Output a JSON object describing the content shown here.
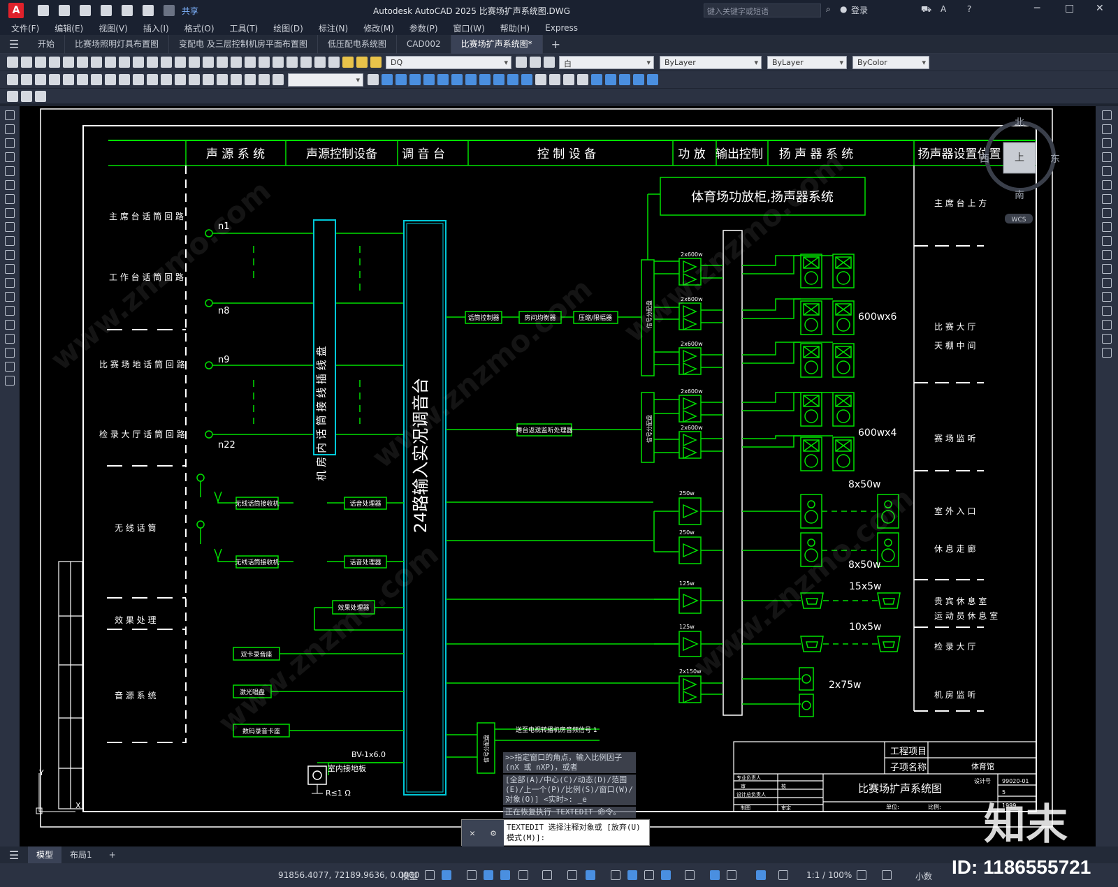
{
  "title_bar": {
    "app_title": "Autodesk AutoCAD 2025    比赛场扩声系统图.DWG",
    "share_label": "共享",
    "search_placeholder": "键入关键字或短语",
    "login_label": "登录"
  },
  "menu": [
    "文件(F)",
    "编辑(E)",
    "视图(V)",
    "插入(I)",
    "格式(O)",
    "工具(T)",
    "绘图(D)",
    "标注(N)",
    "修改(M)",
    "参数(P)",
    "窗口(W)",
    "帮助(H)",
    "Express"
  ],
  "doc_tabs": [
    "开始",
    "比赛场照明灯具布置图",
    "变配电 及三层控制机房平面布置图",
    "低压配电系统图",
    "CAD002",
    "比赛场扩声系统图*"
  ],
  "active_tab_index": 5,
  "toolbar": {
    "layer_value": "DQ",
    "color_value": "白",
    "linetype_value": "ByLayer",
    "lineweight_value": "ByLayer",
    "plotstyle_value": "ByColor"
  },
  "drawing": {
    "headers": [
      "声 源 系 统",
      "声源控制设备",
      "调 音 台",
      "控 制 设 备",
      "功 放",
      "输出控制",
      "扬 声 器 系 统",
      "扬声器设置位置"
    ],
    "mic_groups": [
      "主 席 台 话 筒 回 路",
      "工 作 台 话 筒 回 路",
      "比 赛 场 地 话 筒 回 路",
      "检 录 大 厅 话 筒 回 路",
      "无 线 话 筒",
      "效 果 处 理",
      "音 源 系 统"
    ],
    "node_labels": [
      "n1",
      "n8",
      "n9",
      "n22"
    ],
    "patch_panel": "机 房 内 话 筒 接 线 插 线 盘",
    "mixer": "24路输入实况调音台",
    "cabinet": "体育场功放柜,扬声器系统",
    "control_devices": [
      "话筒控制器",
      "房间均衡器",
      "压缩/限幅器",
      "舞台返送监听处理器"
    ],
    "receivers": [
      "无线话筒接收机",
      "无线话筒接收机"
    ],
    "processors": [
      "话音处理器",
      "话音处理器",
      "效果处理器"
    ],
    "sources": [
      "双卡录音座",
      "激光唱盘",
      "数码录音卡座"
    ],
    "distributors": [
      "信号分配盘",
      "信号分配盘",
      "信号分配盘"
    ],
    "amp_ratings": [
      "2x600w",
      "2x600w",
      "2x600w",
      "2x600w",
      "2x600w",
      "250w",
      "250w",
      "125w",
      "125w",
      "2x150w"
    ],
    "speaker_labels": [
      "600wx6",
      "600wx4",
      "8x50w",
      "8x50w",
      "15x5w",
      "10x5w",
      "2x75w"
    ],
    "locations": [
      "主 席 台 上 方",
      "比 赛 大 厅",
      "天 棚 中 间",
      "赛 场 监 听",
      "室 外 入 口",
      "休 息 走 廊",
      "贵 宾 休 息 室",
      "运 动 员 休 息 室",
      "检 录 大 厅",
      "机 房 监 听"
    ],
    "tv_feed": "送至电视转播机房音频信号 1",
    "ground_cable": "BV-1x6.0",
    "ground_label": "室内接地板",
    "ground_resist": "R≤1 Ω",
    "title_block": {
      "project_label": "工程项目",
      "subname_label": "子项名称",
      "subname_value": "体育馆",
      "drawing_title": "比赛场扩声系统图",
      "rows": [
        "专业负责人",
        "审",
        "核",
        "设计总负责人",
        "制图",
        "审定"
      ],
      "unit_label": "单位:",
      "scale_label": "比例:",
      "number_label": "设计号",
      "number_value": "99020-01",
      "sheet_value": "5",
      "year_value": "1999"
    },
    "viewcube": {
      "north": "北",
      "south": "南",
      "east": "东",
      "west": "西",
      "top": "上",
      "wcs": "WCS"
    },
    "watermark": "www.znzmo.com"
  },
  "command": {
    "history": [
      ">>指定窗口的角点，输入比例因子 (nX 或 nXP)，或者",
      "[全部(A)/中心(C)/动态(D)/范围(E)/上一个(P)/比例(S)/窗口(W)/对象(O)] <实时>: _e",
      "正在恢复执行 TEXTEDIT 命令。"
    ],
    "prompt": "TEXTEDIT 选择注释对象或 [放弃(U) 模式(M)]:"
  },
  "layout_tabs": [
    "模型",
    "布局1"
  ],
  "status": {
    "coords": "91856.4077, 72189.9636, 0.0000",
    "mode": "模型",
    "scale": "1:1 / 100%",
    "units": "小数"
  },
  "watermark_id": "ID: 1186555721",
  "watermark_logo": "知末"
}
